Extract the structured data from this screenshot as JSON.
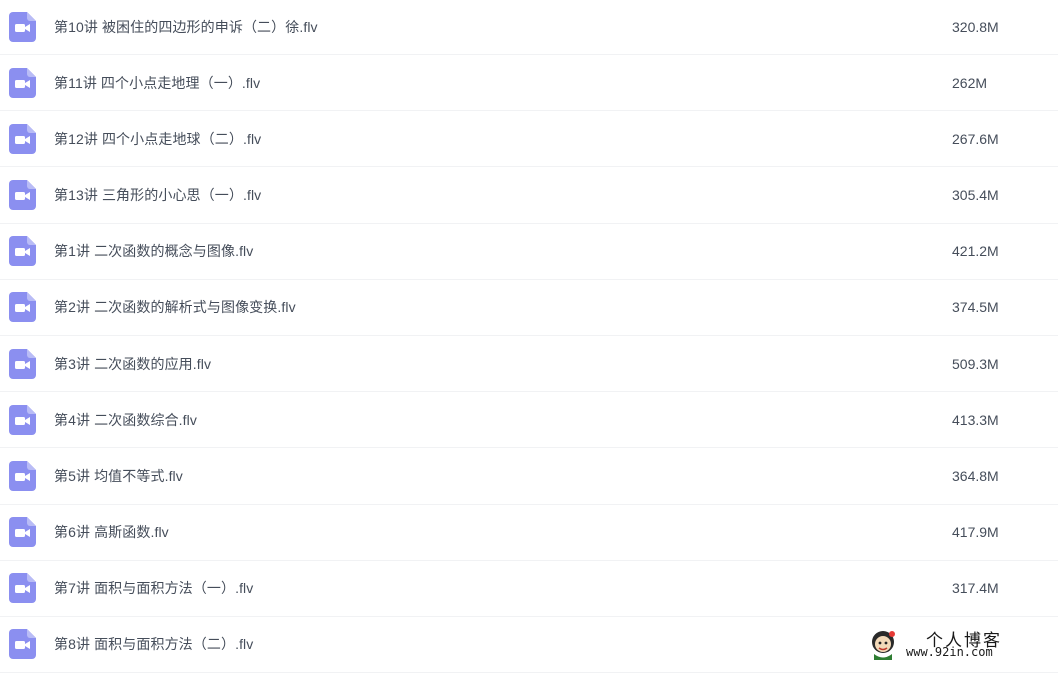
{
  "files": [
    {
      "name": "第10讲 被困住的四边形的申诉（二）徐.flv",
      "size": "320.8M",
      "icon": "video-file-icon"
    },
    {
      "name": "第11讲 四个小点走地理（一）.flv",
      "size": "262M",
      "icon": "video-file-icon"
    },
    {
      "name": "第12讲 四个小点走地球（二）.flv",
      "size": "267.6M",
      "icon": "video-file-icon"
    },
    {
      "name": "第13讲 三角形的小心思（一）.flv",
      "size": "305.4M",
      "icon": "video-file-icon"
    },
    {
      "name": "第1讲 二次函数的概念与图像.flv",
      "size": "421.2M",
      "icon": "video-file-icon"
    },
    {
      "name": "第2讲 二次函数的解析式与图像变换.flv",
      "size": "374.5M",
      "icon": "video-file-icon"
    },
    {
      "name": "第3讲 二次函数的应用.flv",
      "size": "509.3M",
      "icon": "video-file-icon"
    },
    {
      "name": "第4讲 二次函数综合.flv",
      "size": "413.3M",
      "icon": "video-file-icon"
    },
    {
      "name": "第5讲 均值不等式.flv",
      "size": "364.8M",
      "icon": "video-file-icon"
    },
    {
      "name": "第6讲 高斯函数.flv",
      "size": "417.9M",
      "icon": "video-file-icon"
    },
    {
      "name": "第7讲 面积与面积方法（一）.flv",
      "size": "317.4M",
      "icon": "video-file-icon"
    },
    {
      "name": "第8讲 面积与面积方法（二）.flv",
      "size": "",
      "icon": "video-file-icon"
    }
  ],
  "watermark": {
    "title": "个人博客",
    "url": "www.92in.com"
  },
  "colors": {
    "icon": "#8b8ff0",
    "text": "#454d5a",
    "divider": "#f1f2f4"
  }
}
